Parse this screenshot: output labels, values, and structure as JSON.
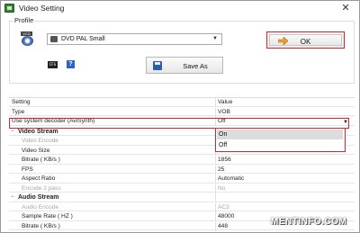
{
  "window": {
    "title": "Video Setting",
    "close_glyph": "✕"
  },
  "profile": {
    "label": "Profile",
    "format": "DVD PAL Small",
    "ok_label": "OK",
    "save_as_label": "Save As"
  },
  "grid": {
    "header": {
      "name": "Setting",
      "value": "Value"
    },
    "rows": [
      {
        "name": "Type",
        "value": "VOB"
      },
      {
        "name": "Use system decoder (AviSynth)",
        "value": "Off"
      },
      {
        "name": "Video Stream",
        "section": true
      },
      {
        "name": "Video Encode",
        "value": "",
        "disabled": true
      },
      {
        "name": "Video Size",
        "value": "",
        "disabled": false
      },
      {
        "name": "Bitrate ( KB/s )",
        "value": "1856"
      },
      {
        "name": "FPS",
        "value": "25"
      },
      {
        "name": "Aspect Ratio",
        "value": "Automatic"
      },
      {
        "name": "Encode 2 pass",
        "value": "No",
        "disabled": true
      },
      {
        "name": "Audio Stream",
        "section": true
      },
      {
        "name": "Audio Encode",
        "value": "AC3",
        "disabled": true
      },
      {
        "name": "Sample Rate ( HZ )",
        "value": "48000"
      },
      {
        "name": "Bitrate ( KB/s )",
        "value": "448"
      }
    ]
  },
  "dropdown": {
    "options": [
      "On",
      "Off"
    ],
    "selected": "On"
  },
  "watermark": "MENTINFO.COM",
  "colors": {
    "highlight": "#d7262b",
    "help_icon": "#2b63c9"
  },
  "icons": [
    "video-setting-app-icon",
    "vcd-disc-icon",
    "format-icon",
    "ok-arrow-icon",
    "config-icon",
    "help-icon",
    "save-icon",
    "chevron-down-icon"
  ]
}
